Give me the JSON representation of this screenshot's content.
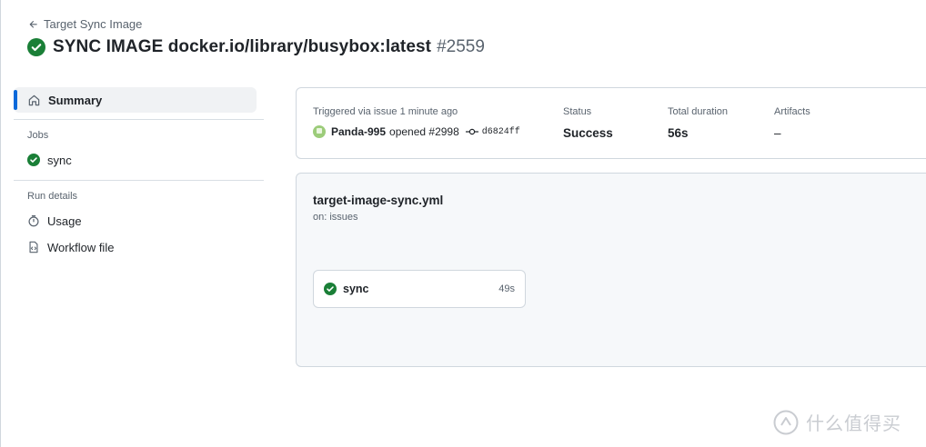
{
  "header": {
    "back_label": "Target Sync Image",
    "title": "SYNC IMAGE docker.io/library/busybox:latest",
    "run_number": "#2559"
  },
  "sidebar": {
    "summary_label": "Summary",
    "jobs_heading": "Jobs",
    "jobs": [
      {
        "label": "sync"
      }
    ],
    "run_details_heading": "Run details",
    "run_details": [
      {
        "label": "Usage"
      },
      {
        "label": "Workflow file"
      }
    ]
  },
  "summary": {
    "trigger_label": "Triggered via issue 1 minute ago",
    "trigger_user": "Panda-995",
    "trigger_action": "opened #2998",
    "commit_sha": "d6824ff",
    "status_label": "Status",
    "status_value": "Success",
    "duration_label": "Total duration",
    "duration_value": "56s",
    "artifacts_label": "Artifacts",
    "artifacts_value": "–"
  },
  "workflow": {
    "file_name": "target-image-sync.yml",
    "trigger": "on: issues",
    "jobs": [
      {
        "name": "sync",
        "duration": "49s"
      }
    ]
  },
  "watermark": {
    "text": "什么值得买"
  },
  "colors": {
    "success": "#1a7f37",
    "accent": "#0969da",
    "muted": "#59636e",
    "border": "#d0d7de"
  }
}
